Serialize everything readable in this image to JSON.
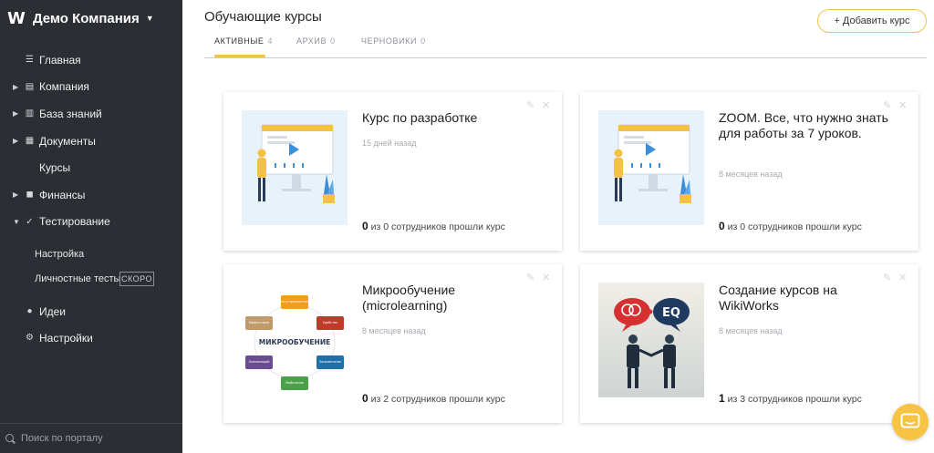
{
  "sidebar": {
    "brand": {
      "logo": "W",
      "name": "Демо Компания"
    },
    "items": [
      {
        "label": "Главная",
        "icon": "list-icon",
        "expandable": false
      },
      {
        "label": "Компания",
        "icon": "building-icon",
        "expandable": true
      },
      {
        "label": "База знаний",
        "icon": "book-icon",
        "expandable": true
      },
      {
        "label": "Документы",
        "icon": "document-icon",
        "expandable": true
      },
      {
        "label": "Курсы",
        "icon": "courses-icon",
        "expandable": false
      },
      {
        "label": "Финансы",
        "icon": "finance-icon",
        "expandable": true
      },
      {
        "label": "Тестирование",
        "icon": "test-icon",
        "expandable": true,
        "expanded": true
      }
    ],
    "subitems": [
      {
        "label": "Настройка"
      },
      {
        "label": "Личностные тесты",
        "badge": "СКОРО"
      }
    ],
    "bottom_items": [
      {
        "label": "Идеи",
        "icon": "bulb-icon"
      },
      {
        "label": "Настройки",
        "icon": "gear-icon"
      }
    ],
    "search": {
      "placeholder": "Поиск по порталу"
    }
  },
  "header": {
    "title": "Обучающие курсы",
    "add_button": "+ Добавить курс",
    "tabs": [
      {
        "label": "АКТИВНЫЕ",
        "count": "4",
        "active": true
      },
      {
        "label": "АРХИВ",
        "count": "0",
        "active": false
      },
      {
        "label": "ЧЕРНОВИКИ",
        "count": "0",
        "active": false
      }
    ]
  },
  "courses": [
    {
      "title": "Курс по разработке",
      "date": "15 дней назад",
      "passed": "0",
      "stats_text": "из 0 сотрудников прошли курс",
      "thumb": "presentation"
    },
    {
      "title": "ZOOM. Все, что нужно знать для работы за 7 уроков.",
      "date": "8 месяцев назад",
      "passed": "0",
      "stats_text": "из 0 сотрудников прошли курс",
      "thumb": "presentation"
    },
    {
      "title": "Микрообучение (microlearning)",
      "date": "8 месяцев назад",
      "passed": "0",
      "stats_text": "из 2 сотрудников прошли курс",
      "thumb": "microlearning",
      "diagram": {
        "center": "МИКРООБУЧЕНИЕ",
        "nodes": [
          "Цели и предпочтения",
          "Удобство",
          "Запоминание",
          "Мобильное",
          "Экономящий",
          "Эффективно"
        ]
      }
    },
    {
      "title": "Создание курсов на WikiWorks",
      "date": "8 месяцев назад",
      "passed": "1",
      "stats_text": "из 3 сотрудников прошли курс",
      "thumb": "eq",
      "eq_label": "EQ"
    }
  ],
  "colors": {
    "sidebar_bg": "#2b2e33",
    "accent": "#f4c443"
  }
}
